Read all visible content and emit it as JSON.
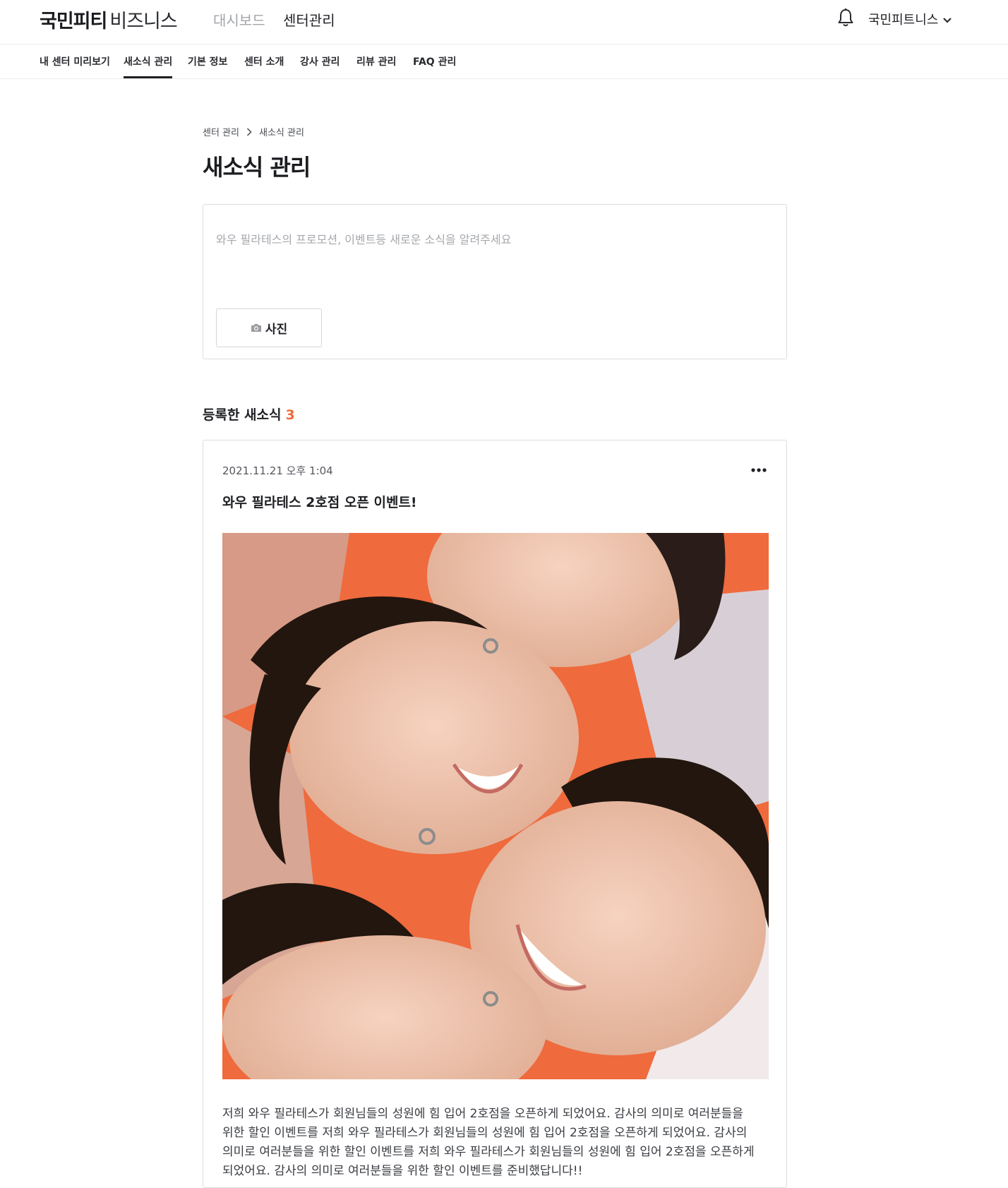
{
  "header": {
    "logo_main": "국민피티",
    "logo_sub": "비즈니스",
    "nav": [
      {
        "label": "대시보드",
        "active": false
      },
      {
        "label": "센터관리",
        "active": true
      }
    ],
    "notification_icon": "bell-icon",
    "account_name": "국민피트니스",
    "account_icon": "chevron-down-icon"
  },
  "subnav": {
    "items": [
      {
        "label": "내 센터 미리보기",
        "active": false
      },
      {
        "label": "새소식 관리",
        "active": true
      },
      {
        "label": "기본 정보",
        "active": false
      },
      {
        "label": "센터 소개",
        "active": false
      },
      {
        "label": "강사 관리",
        "active": false
      },
      {
        "label": "리뷰 관리",
        "active": false
      },
      {
        "label": "FAQ 관리",
        "active": false
      }
    ]
  },
  "breadcrumb": {
    "items": [
      "센터 관리",
      "새소식 관리"
    ],
    "separator_icon": "chevron-right-icon"
  },
  "page_title": "새소식 관리",
  "composer": {
    "placeholder": "와우 필라테스의 프로모션, 이벤트등 새로운 소식을 알려주세요",
    "value": "",
    "photo_button_label": "사진",
    "photo_icon": "camera-icon"
  },
  "posts_section": {
    "title": "등록한 새소식",
    "count": "3"
  },
  "posts": [
    {
      "date": "2021.11.21 오후 1:04",
      "title": "와우 필라테스 2호점 오픈 이벤트!",
      "more_icon": "more-horizontal-icon",
      "image": "photo of four smiling women with heads together on orange background",
      "body": "저희 와우 필라테스가 회원님들의 성원에 힘 입어 2호점을 오픈하게 되었어요. 감사의 의미로 여러분들을 위한 할인 이벤트를 저희 와우 필라테스가 회원님들의 성원에 힘 입어 2호점을 오픈하게 되었어요. 감사의 의미로 여러분들을 위한 할인 이벤트를 저희 와우 필라테스가 회원님들의 성원에 힘 입어 2호점을 오픈하게 되었어요. 감사의 의미로 여러분들을 위한 할인 이벤트를 준비했답니다!!"
    }
  ],
  "colors": {
    "accent": "#f06a3a",
    "text": "#1f2024",
    "muted": "#a3a5ab",
    "border": "#dcdde0",
    "image_background": "#ef6a3d"
  }
}
